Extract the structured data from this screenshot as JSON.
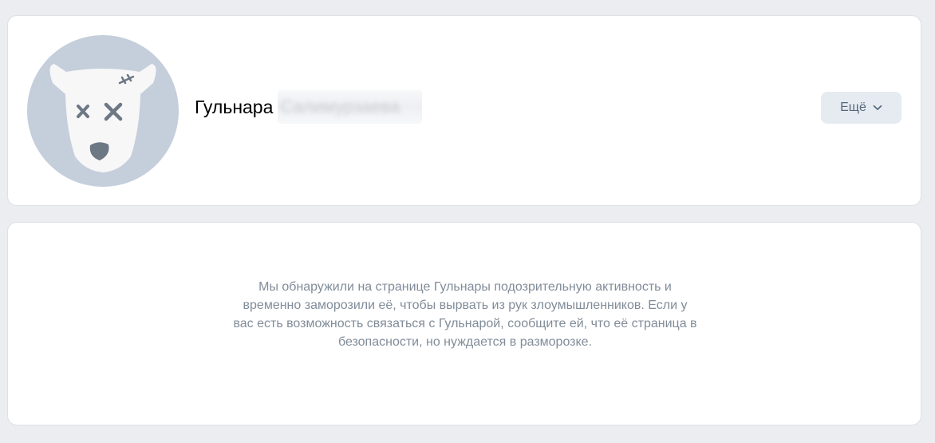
{
  "profile": {
    "first_name": "Гульнара",
    "last_name_hidden": "Салимурзаева",
    "more_button_label": "Ещё",
    "avatar_icon": "frozen-dog-icon"
  },
  "message": {
    "text": "Мы обнаружили на странице Гульнары подозрительную активность и временно заморозили её, чтобы вырвать из рук злоумышленников. Если у вас есть возможность связаться с Гульнарой, сообщите ей, что её страница в безопасности, но нуждается в разморозке."
  },
  "colors": {
    "background": "#ebedf0",
    "card": "#ffffff",
    "avatar_bg": "#c5cedb",
    "button_bg": "#e5ebf1",
    "button_text": "#55677d",
    "message_text": "#818c99"
  }
}
